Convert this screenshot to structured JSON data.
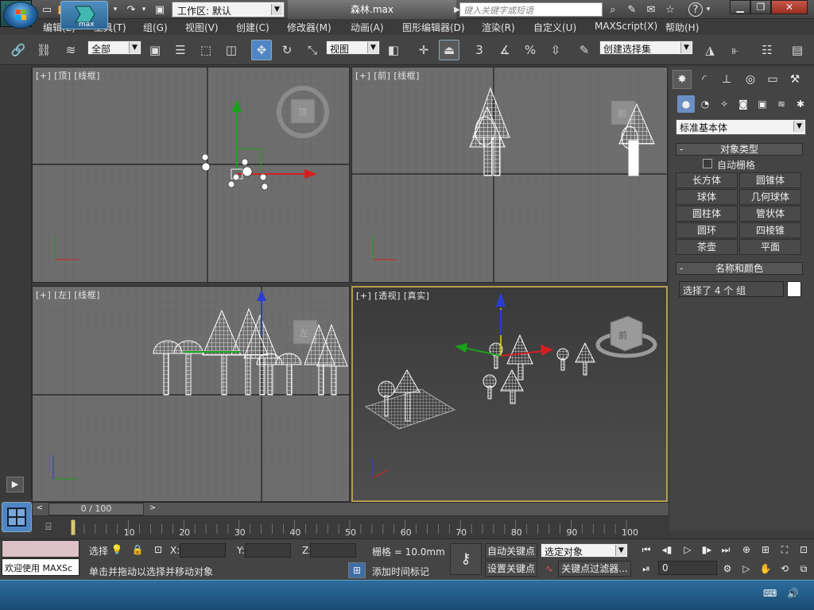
{
  "titlebar": {
    "workspace_label": "工作区: 默认",
    "document_title": "森林.max",
    "search_placeholder": "键入关键字或短语",
    "help_label": "?"
  },
  "menu": {
    "items": [
      "编辑(E)",
      "工具(T)",
      "组(G)",
      "视图(V)",
      "创建(C)",
      "修改器(M)",
      "动画(A)",
      "图形编辑器(D)",
      "渲染(R)",
      "自定义(U)",
      "MAXScript(X)",
      "帮助(H)"
    ]
  },
  "toolbar": {
    "selection_filter": "全部",
    "ref_coord": "视图",
    "snap_3": "3",
    "percent_snap": "%",
    "named_selection": "创建选择集"
  },
  "viewports": {
    "top": {
      "label": "[+] [顶] [线框]",
      "viewcube": "顶"
    },
    "front": {
      "label": "[+] [前] [线框]",
      "viewcube": "前"
    },
    "left": {
      "label": "[+] [左] [线框]",
      "viewcube": "左"
    },
    "persp": {
      "label": "[+] [透视] [真实]",
      "viewcube": "前"
    }
  },
  "command_panel": {
    "dropdown": "标准基本体",
    "object_type_title": "对象类型",
    "autogrid_label": "自动栅格",
    "buttons": [
      "长方体",
      "圆锥体",
      "球体",
      "几何球体",
      "圆柱体",
      "管状体",
      "圆环",
      "四棱锥",
      "茶壶",
      "平面"
    ],
    "name_color_title": "名称和颜色",
    "name_field": "选择了 4 个 组",
    "color_swatch": "#ffffff"
  },
  "timeline": {
    "slider_text": "0 / 100",
    "ticks": [
      "10",
      "20",
      "30",
      "40",
      "50",
      "60",
      "70",
      "80",
      "90",
      "100"
    ],
    "current_frame": 0,
    "total_frames": 100
  },
  "status": {
    "maxscript_listener": "欢迎使用 MAXSc",
    "selected_label": "选择",
    "x_label": "X:",
    "y_label": "Y:",
    "z_label": "Z:",
    "x_value": "",
    "y_value": "",
    "z_value": "",
    "grid_label": "栅格 = 10.0mm",
    "prompt": "单击并拖动以选择并移动对象",
    "add_time_tag": "添加时间标记",
    "auto_key": "自动关键点",
    "set_key": "设置关键点",
    "key_mode_select": "选定对象",
    "key_filters": "关键点过滤器...",
    "frame_value": "0"
  },
  "taskbar": {
    "app_label": "max"
  }
}
